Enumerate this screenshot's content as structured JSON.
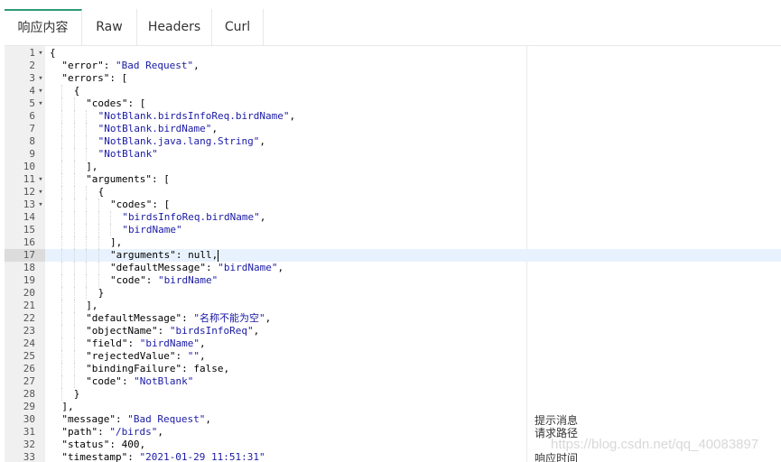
{
  "tabs": [
    {
      "label": "响应内容",
      "active": true
    },
    {
      "label": "Raw",
      "active": false
    },
    {
      "label": "Headers",
      "active": false
    },
    {
      "label": "Curl",
      "active": false
    }
  ],
  "active_line": 17,
  "lines": [
    {
      "n": 1,
      "fold": true,
      "indent": 0,
      "tokens": [
        [
          "p",
          "{"
        ]
      ]
    },
    {
      "n": 2,
      "fold": false,
      "indent": 1,
      "tokens": [
        [
          "k",
          "\"error\""
        ],
        [
          "p",
          ": "
        ],
        [
          "s",
          "\"Bad Request\""
        ],
        [
          "p",
          ","
        ]
      ]
    },
    {
      "n": 3,
      "fold": true,
      "indent": 1,
      "tokens": [
        [
          "k",
          "\"errors\""
        ],
        [
          "p",
          ": ["
        ]
      ]
    },
    {
      "n": 4,
      "fold": true,
      "indent": 2,
      "tokens": [
        [
          "p",
          "{"
        ]
      ]
    },
    {
      "n": 5,
      "fold": true,
      "indent": 3,
      "tokens": [
        [
          "k",
          "\"codes\""
        ],
        [
          "p",
          ": ["
        ]
      ]
    },
    {
      "n": 6,
      "fold": false,
      "indent": 4,
      "tokens": [
        [
          "s",
          "\"NotBlank.birdsInfoReq.birdName\""
        ],
        [
          "p",
          ","
        ]
      ]
    },
    {
      "n": 7,
      "fold": false,
      "indent": 4,
      "tokens": [
        [
          "s",
          "\"NotBlank.birdName\""
        ],
        [
          "p",
          ","
        ]
      ]
    },
    {
      "n": 8,
      "fold": false,
      "indent": 4,
      "tokens": [
        [
          "s",
          "\"NotBlank.java.lang.String\""
        ],
        [
          "p",
          ","
        ]
      ]
    },
    {
      "n": 9,
      "fold": false,
      "indent": 4,
      "tokens": [
        [
          "s",
          "\"NotBlank\""
        ]
      ]
    },
    {
      "n": 10,
      "fold": false,
      "indent": 3,
      "tokens": [
        [
          "p",
          "],"
        ]
      ]
    },
    {
      "n": 11,
      "fold": true,
      "indent": 3,
      "tokens": [
        [
          "k",
          "\"arguments\""
        ],
        [
          "p",
          ": ["
        ]
      ]
    },
    {
      "n": 12,
      "fold": true,
      "indent": 4,
      "tokens": [
        [
          "p",
          "{"
        ]
      ]
    },
    {
      "n": 13,
      "fold": true,
      "indent": 5,
      "tokens": [
        [
          "k",
          "\"codes\""
        ],
        [
          "p",
          ": ["
        ]
      ]
    },
    {
      "n": 14,
      "fold": false,
      "indent": 6,
      "tokens": [
        [
          "s",
          "\"birdsInfoReq.birdName\""
        ],
        [
          "p",
          ","
        ]
      ]
    },
    {
      "n": 15,
      "fold": false,
      "indent": 6,
      "tokens": [
        [
          "s",
          "\"birdName\""
        ]
      ]
    },
    {
      "n": 16,
      "fold": false,
      "indent": 5,
      "tokens": [
        [
          "p",
          "],"
        ]
      ]
    },
    {
      "n": 17,
      "fold": false,
      "indent": 5,
      "tokens": [
        [
          "k",
          "\"arguments\""
        ],
        [
          "p",
          ": "
        ],
        [
          "w",
          "null"
        ],
        [
          "p",
          ","
        ]
      ]
    },
    {
      "n": 18,
      "fold": false,
      "indent": 5,
      "tokens": [
        [
          "k",
          "\"defaultMessage\""
        ],
        [
          "p",
          ": "
        ],
        [
          "s",
          "\"birdName\""
        ],
        [
          "p",
          ","
        ]
      ]
    },
    {
      "n": 19,
      "fold": false,
      "indent": 5,
      "tokens": [
        [
          "k",
          "\"code\""
        ],
        [
          "p",
          ": "
        ],
        [
          "s",
          "\"birdName\""
        ]
      ]
    },
    {
      "n": 20,
      "fold": false,
      "indent": 4,
      "tokens": [
        [
          "p",
          "}"
        ]
      ]
    },
    {
      "n": 21,
      "fold": false,
      "indent": 3,
      "tokens": [
        [
          "p",
          "],"
        ]
      ]
    },
    {
      "n": 22,
      "fold": false,
      "indent": 3,
      "tokens": [
        [
          "k",
          "\"defaultMessage\""
        ],
        [
          "p",
          ": "
        ],
        [
          "s",
          "\"名称不能为空\""
        ],
        [
          "p",
          ","
        ]
      ]
    },
    {
      "n": 23,
      "fold": false,
      "indent": 3,
      "tokens": [
        [
          "k",
          "\"objectName\""
        ],
        [
          "p",
          ": "
        ],
        [
          "s",
          "\"birdsInfoReq\""
        ],
        [
          "p",
          ","
        ]
      ]
    },
    {
      "n": 24,
      "fold": false,
      "indent": 3,
      "tokens": [
        [
          "k",
          "\"field\""
        ],
        [
          "p",
          ": "
        ],
        [
          "s",
          "\"birdName\""
        ],
        [
          "p",
          ","
        ]
      ]
    },
    {
      "n": 25,
      "fold": false,
      "indent": 3,
      "tokens": [
        [
          "k",
          "\"rejectedValue\""
        ],
        [
          "p",
          ": "
        ],
        [
          "s",
          "\"\""
        ],
        [
          "p",
          ","
        ]
      ]
    },
    {
      "n": 26,
      "fold": false,
      "indent": 3,
      "tokens": [
        [
          "k",
          "\"bindingFailure\""
        ],
        [
          "p",
          ": "
        ],
        [
          "w",
          "false"
        ],
        [
          "p",
          ","
        ]
      ]
    },
    {
      "n": 27,
      "fold": false,
      "indent": 3,
      "tokens": [
        [
          "k",
          "\"code\""
        ],
        [
          "p",
          ": "
        ],
        [
          "s",
          "\"NotBlank\""
        ]
      ]
    },
    {
      "n": 28,
      "fold": false,
      "indent": 2,
      "tokens": [
        [
          "p",
          "}"
        ]
      ]
    },
    {
      "n": 29,
      "fold": false,
      "indent": 1,
      "tokens": [
        [
          "p",
          "],"
        ]
      ]
    },
    {
      "n": 30,
      "fold": false,
      "indent": 1,
      "tokens": [
        [
          "k",
          "\"message\""
        ],
        [
          "p",
          ": "
        ],
        [
          "s",
          "\"Bad Request\""
        ],
        [
          "p",
          ","
        ]
      ]
    },
    {
      "n": 31,
      "fold": false,
      "indent": 1,
      "tokens": [
        [
          "k",
          "\"path\""
        ],
        [
          "p",
          ": "
        ],
        [
          "s",
          "\"/birds\""
        ],
        [
          "p",
          ","
        ]
      ]
    },
    {
      "n": 32,
      "fold": false,
      "indent": 1,
      "tokens": [
        [
          "k",
          "\"status\""
        ],
        [
          "p",
          ": "
        ],
        [
          "w",
          "400"
        ],
        [
          "p",
          ","
        ]
      ]
    },
    {
      "n": 33,
      "fold": false,
      "indent": 1,
      "tokens": [
        [
          "k",
          "\"timestamp\""
        ],
        [
          "p",
          ": "
        ],
        [
          "s",
          "\"2021-01-29 11:51:31\""
        ]
      ]
    }
  ],
  "notes": [
    {
      "line": 30,
      "text": "提示消息"
    },
    {
      "line": 31,
      "text": "请求路径"
    },
    {
      "line": 33,
      "text": "响应时间"
    }
  ],
  "watermark": "https://blog.csdn.net/qq_40083897",
  "colors": {
    "accent": "#2e9a78",
    "string": "#1a1aa6",
    "active_line": "#e8f2fe",
    "gutter": "#f0f0f0"
  },
  "icons": {
    "fold": "chevron-down-icon"
  }
}
